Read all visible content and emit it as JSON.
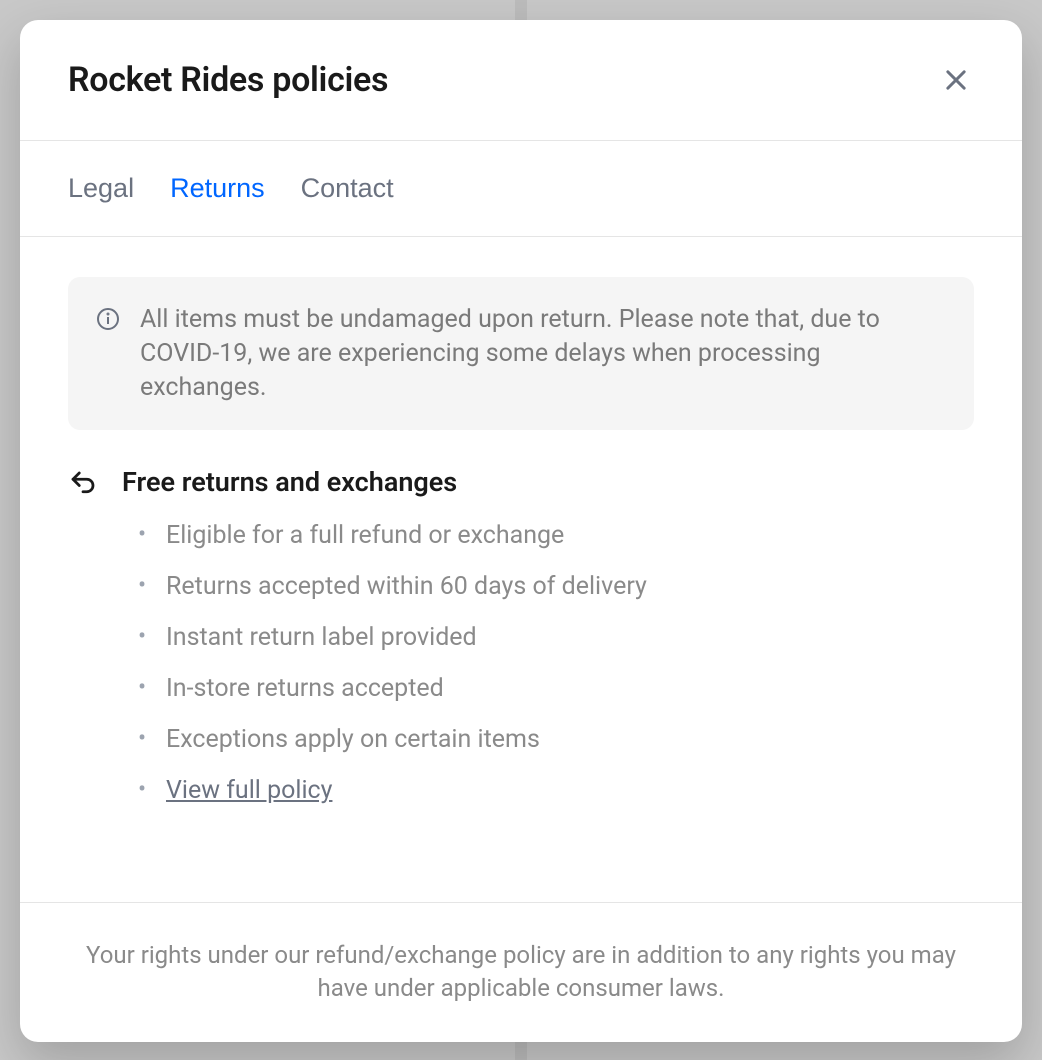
{
  "modal": {
    "title": "Rocket Rides policies"
  },
  "tabs": {
    "legal": "Legal",
    "returns": "Returns",
    "contact": "Contact",
    "active": "returns"
  },
  "banner": {
    "text": "All items must be undamaged upon return. Please note that, due to COVID-19, we are experiencing some delays when processing exchanges."
  },
  "section": {
    "title": "Free returns and exchanges",
    "items": [
      "Eligible for a full refund or exchange",
      "Returns accepted within 60 days of delivery",
      "Instant return label provided",
      "In-store returns accepted",
      "Exceptions apply on certain items"
    ],
    "link_label": "View full policy"
  },
  "footer": {
    "text": "Your rights under our refund/exchange policy are in addition to any rights you may have under applicable consumer laws."
  }
}
